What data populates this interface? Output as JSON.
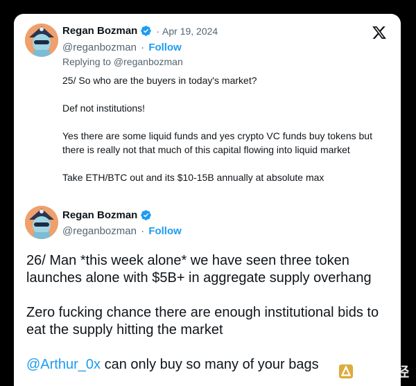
{
  "platform": {
    "logo_icon": "x-logo-icon"
  },
  "tweets": [
    {
      "author_name": "Regan Bozman",
      "verified_icon": "verified-badge-icon",
      "separator": "·",
      "date": "Apr 19, 2024",
      "handle": "@reganbozman",
      "handle_separator": "·",
      "follow_label": "Follow",
      "replying_to": "Replying to @reganbozman",
      "lines": [
        "25/ So who are the buyers in today's market?",
        "Def not institutions!",
        "Yes there are some liquid funds and yes crypto VC funds buy tokens but there is really not that much of this capital flowing into liquid market",
        "Take ETH/BTC out and its $10-15B annually at absolute max"
      ]
    },
    {
      "author_name": "Regan Bozman",
      "verified_icon": "verified-badge-icon",
      "handle": "@reganbozman",
      "handle_separator": "·",
      "follow_label": "Follow",
      "lines": [
        "26/ Man *this week alone* we have seen three token launches alone with $5B+ in aggregate supply overhang",
        "Zero fucking chance there are enough institutional bids to eat the supply hitting the market"
      ],
      "mention": "@Arthur_0x",
      "last_line_rest": " can only buy so many of your bags"
    }
  ],
  "watermark": {
    "text": "金色财经",
    "icon": "golden-finance-logo-icon"
  },
  "colors": {
    "link": "#1d9bf0",
    "secondary": "#536471",
    "text": "#0f1419",
    "background": "#000000",
    "card": "#ffffff"
  }
}
